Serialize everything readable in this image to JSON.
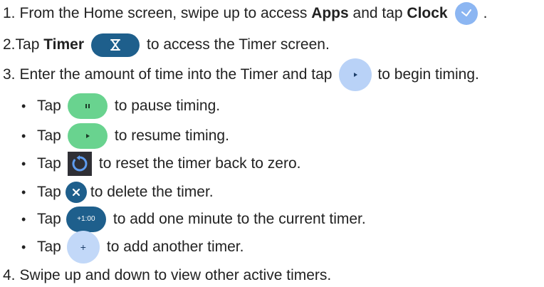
{
  "steps": [
    {
      "num": "1.",
      "a": "From the Home screen, swipe up to access ",
      "b1": "Apps",
      "b": " and tap ",
      "b2": "Clock",
      "c": "."
    },
    {
      "num": "2.",
      "a": "Tap ",
      "b1": "Timer",
      "c": "to access the Timer screen."
    },
    {
      "num": "3.",
      "a": "Enter the amount of time into the Timer and tap",
      "c": "to begin timing."
    },
    {
      "num": "4.",
      "a": "Swipe up and down to view other active timers."
    }
  ],
  "bullets": [
    {
      "a": "Tap",
      "c": "to pause timing."
    },
    {
      "a": "Tap",
      "c": "to resume timing."
    },
    {
      "a": "Tap",
      "c": "to reset the timer back to zero."
    },
    {
      "a": "Tap",
      "c": "to delete the timer."
    },
    {
      "a": "Tap",
      "icon_text": "+1:00",
      "c": "to add one minute to the current timer."
    },
    {
      "a": "Tap",
      "c": "to add another timer."
    }
  ],
  "bullet_char": "•",
  "icons": {
    "clock": "clock-icon",
    "timer": "hourglass-icon",
    "start": "play-icon",
    "pause": "pause-icon",
    "resume": "play-icon",
    "reset": "reset-icon",
    "delete": "close-icon",
    "add_minute": "add-minute-icon",
    "add_timer": "plus-icon"
  },
  "colors": {
    "text": "#222222",
    "clock_blue": "#8cb6f2",
    "timer_pill": "#1e5f8c",
    "start_blue": "#b9d2f7",
    "green": "#69d38f",
    "reset_bg": "#2f2f35",
    "reset_arrow": "#5e9cf0",
    "delete_bg": "#1e5f8c",
    "add_minute_bg": "#1e5f8c",
    "add_timer_bg": "#c2d8f8"
  }
}
